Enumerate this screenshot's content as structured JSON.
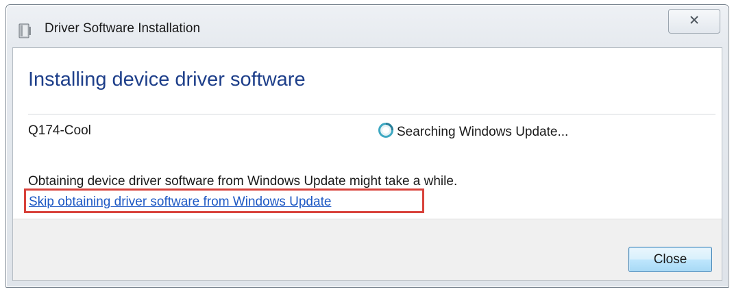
{
  "window": {
    "title": "Driver Software Installation",
    "title_icon": "device-install-icon",
    "close_icon": "close-icon"
  },
  "main": {
    "heading": "Installing device driver software",
    "device_name": "Q174-Cool",
    "status_icon": "searching-spinner-icon",
    "status_text": "Searching Windows Update...",
    "info_text": "Obtaining device driver software from Windows Update might take a while.",
    "skip_link": "Skip obtaining driver software from Windows Update"
  },
  "footer": {
    "close_label": "Close"
  },
  "colors": {
    "heading": "#1e3f8a",
    "link": "#1d58c4",
    "highlight": "#d8413a",
    "button_border": "#3c7fb1"
  }
}
